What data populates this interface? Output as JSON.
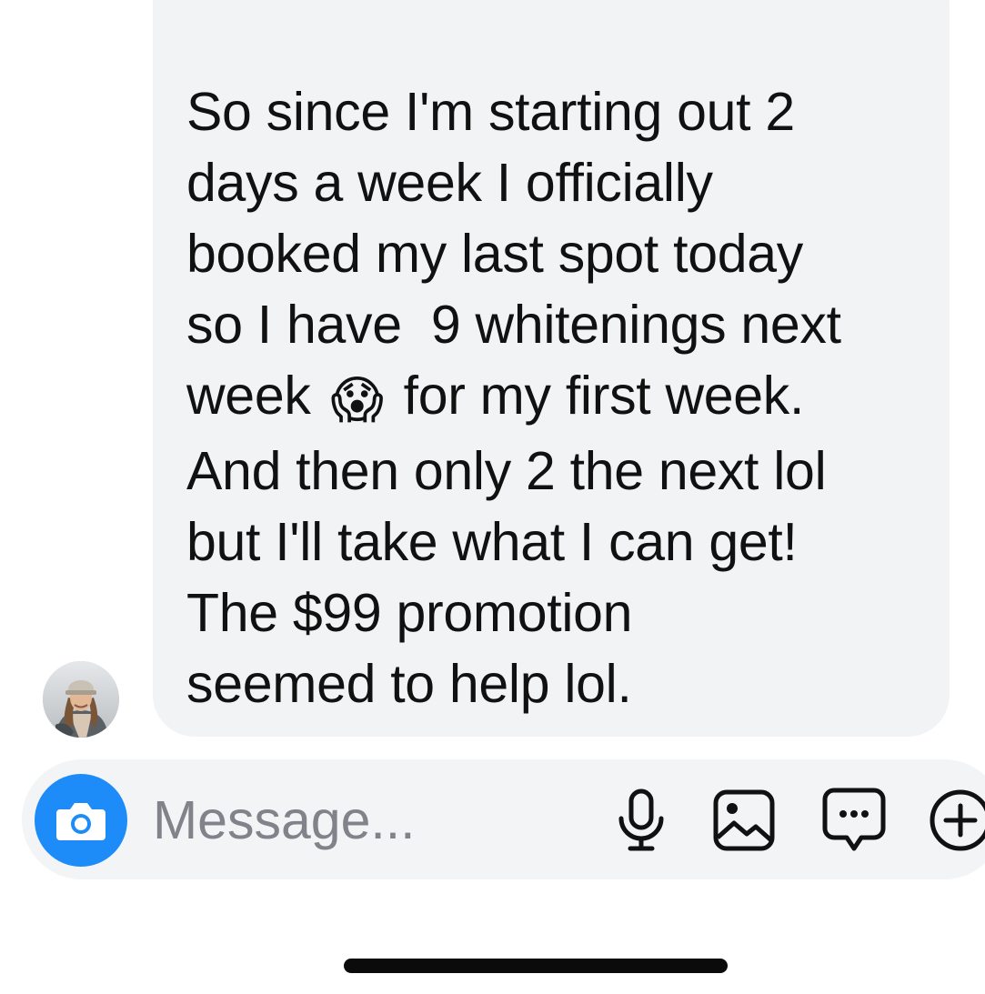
{
  "message": {
    "lines": [
      "So since I'm starting out 2",
      "days a week I officially",
      "booked my last spot today",
      "so I have  9 whitenings next",
      "week",
      "for my first week.",
      "And then only 2 the next lol",
      "but I'll take what I can get!",
      "The $99 promotion",
      "seemed to help lol."
    ],
    "emoji": "😱"
  },
  "composer": {
    "placeholder": "Message...",
    "value": ""
  },
  "icons": {
    "camera": "camera-icon",
    "mic": "microphone-icon",
    "gallery": "image-gallery-icon",
    "chat": "chat-bubble-icon",
    "plus": "plus-circle-icon"
  },
  "colors": {
    "accent": "#1d8cf8",
    "bubble": "#f2f3f5",
    "composer": "#f3f4f6",
    "text": "#111111",
    "placeholder": "#808389"
  }
}
